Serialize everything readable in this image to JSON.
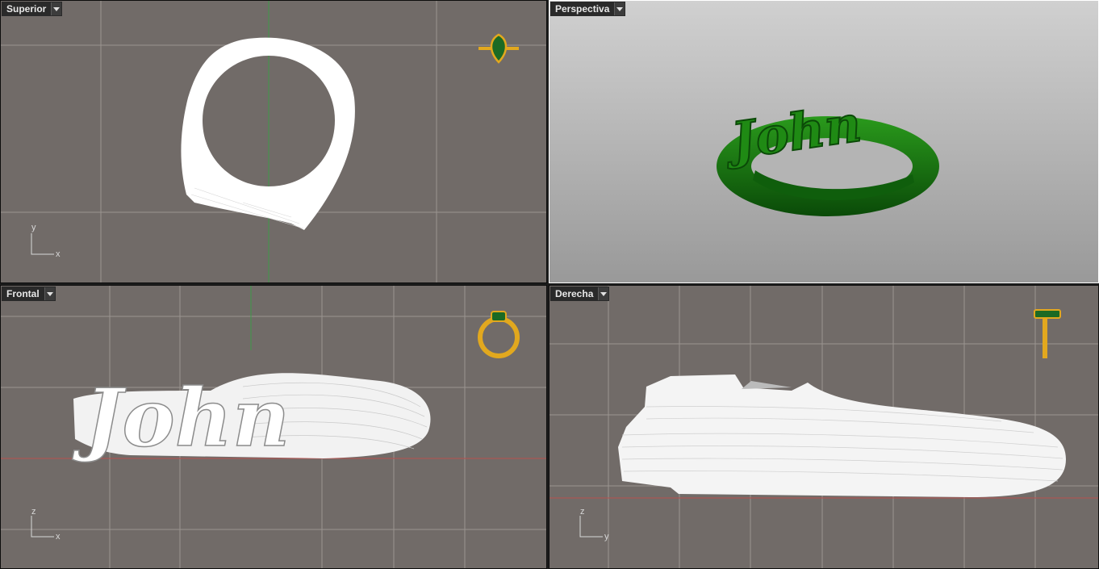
{
  "viewports": {
    "top": {
      "label": "Superior",
      "axes": {
        "horizontal": "x",
        "vertical": "y"
      }
    },
    "perspective": {
      "label": "Perspectiva"
    },
    "front": {
      "label": "Frontal",
      "axes": {
        "horizontal": "x",
        "vertical": "z"
      }
    },
    "right": {
      "label": "Derecha",
      "axes": {
        "horizontal": "y",
        "vertical": "z"
      }
    }
  },
  "model": {
    "text": "John"
  },
  "colors": {
    "grid_bg": "#716b68",
    "grid_line": "#9a9490",
    "mesh": "#ffffff",
    "x_axis": "#b8504e",
    "y_axis": "#3f9a48",
    "render_green": "#1a7a12",
    "thumbnail_gold": "#e2a81e",
    "thumbnail_gem": "#1b6a24"
  }
}
